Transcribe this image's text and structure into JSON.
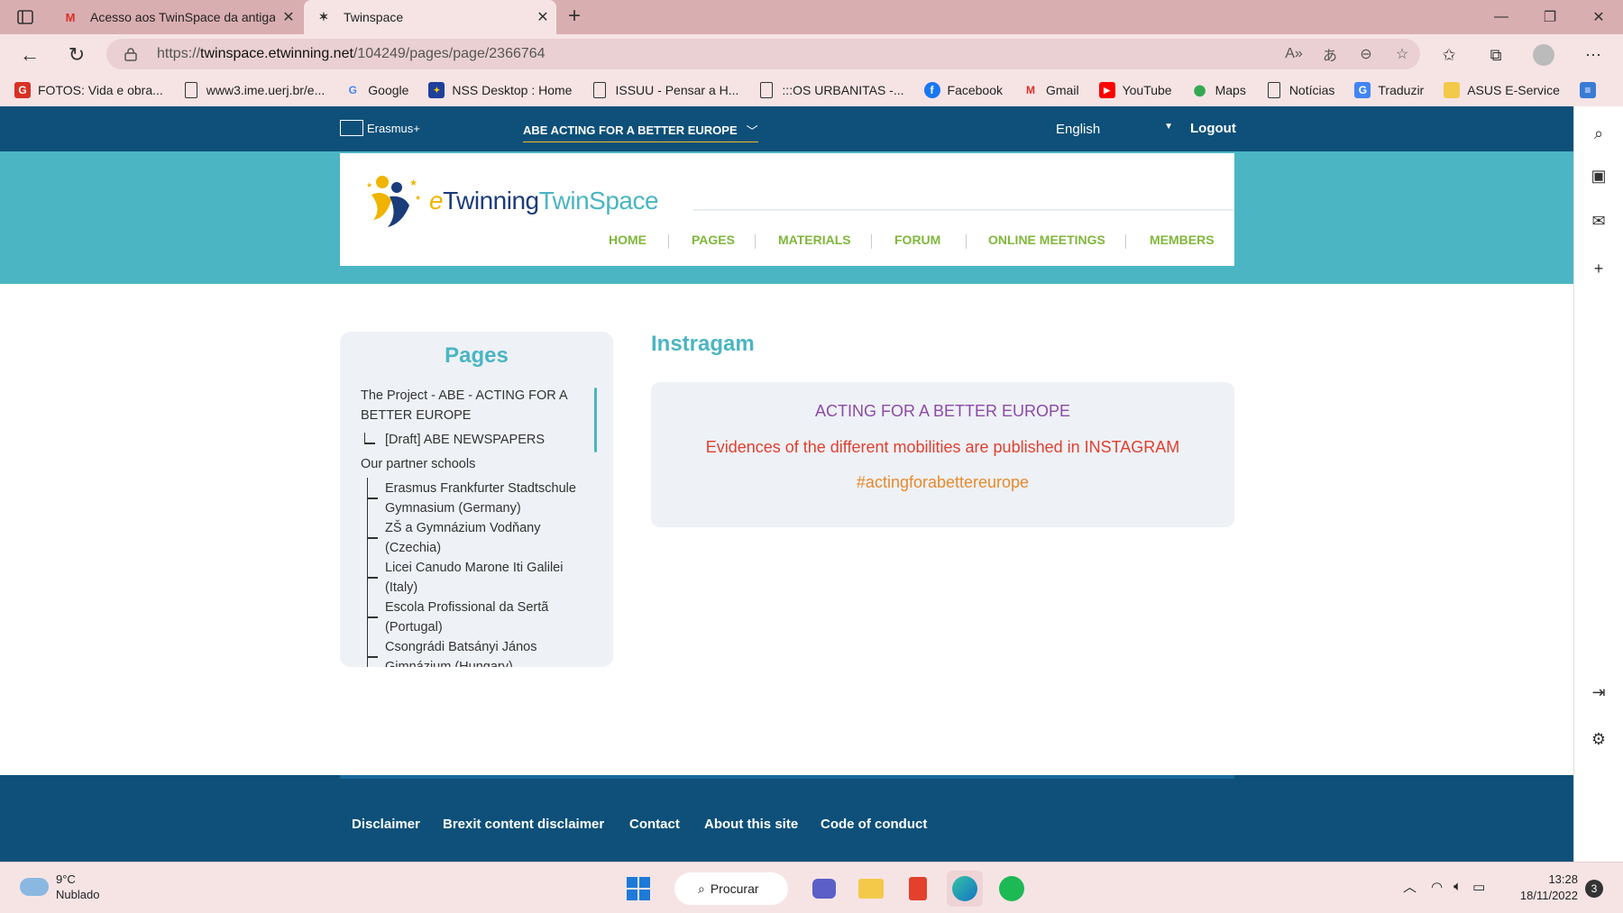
{
  "browser": {
    "tabs": [
      {
        "title": "Acesso aos TwinSpace da antiga",
        "favicon": "gmail-icon"
      },
      {
        "title": "Twinspace",
        "favicon": "twinspace-icon",
        "active": true
      }
    ],
    "address": {
      "prefix": "https://",
      "host": "twinspace.etwinning.net",
      "path": "/104249/pages/page/2366764"
    },
    "bookmarks": [
      {
        "label": "FOTOS: Vida e obra...",
        "icon": "gmail-red-icon"
      },
      {
        "label": "www3.ime.uerj.br/e...",
        "icon": "page-icon"
      },
      {
        "label": "Google",
        "icon": "google-icon"
      },
      {
        "label": "NSS Desktop : Home",
        "icon": "eu-flag-icon"
      },
      {
        "label": "ISSUU - Pensar a H...",
        "icon": "page-icon"
      },
      {
        "label": ":::OS URBANITAS -...",
        "icon": "page-icon"
      },
      {
        "label": "Facebook",
        "icon": "facebook-icon"
      },
      {
        "label": "Gmail",
        "icon": "gmail-icon"
      },
      {
        "label": "YouTube",
        "icon": "youtube-icon"
      },
      {
        "label": "Maps",
        "icon": "maps-icon"
      },
      {
        "label": "Notícias",
        "icon": "page-icon"
      },
      {
        "label": "Traduzir",
        "icon": "translate-icon"
      },
      {
        "label": "ASUS E-Service",
        "icon": "folder-icon"
      }
    ]
  },
  "site": {
    "topbar": {
      "brand": "Erasmus+",
      "project": "ABE ACTING FOR A BETTER EUROPE",
      "language": "English",
      "logout": "Logout"
    },
    "logo": {
      "part1": "Twinning",
      "part2": "TwinSpace",
      "e": "e"
    },
    "nav": [
      "HOME",
      "PAGES",
      "MATERIALS",
      "FORUM",
      "ONLINE MEETINGS",
      "MEMBERS"
    ],
    "sidebar": {
      "title": "Pages",
      "items": [
        {
          "label1": "The Project - ABE - ACTING FOR A",
          "label2": "BETTER EUROPE"
        },
        {
          "label1": "[Draft] ABE NEWSPAPERS"
        },
        {
          "label1": "Our partner schools"
        },
        {
          "label1": "Erasmus Frankfurter Stadtschule",
          "label2": "Gymnasium (Germany)"
        },
        {
          "label1": "ZŠ a Gymnázium Vodňany",
          "label2": "(Czechia)"
        },
        {
          "label1": "Licei Canudo Marone Iti Galilei",
          "label2": "(Italy)"
        },
        {
          "label1": "Escola Profissional da Sertã",
          "label2": "(Portugal)"
        },
        {
          "label1": "Csongrádi Batsányi János",
          "label2": "Gimnázium (Hungary)"
        }
      ]
    },
    "content": {
      "title": "Instragam",
      "line1": "ACTING FOR A BETTER EUROPE",
      "line2": "Evidences of the different mobilities are published in INSTAGRAM",
      "line3": "#actingforabettereurope"
    },
    "footer": [
      "Disclaimer",
      "Brexit content disclaimer",
      "Contact",
      "About this site",
      "Code of conduct"
    ]
  },
  "taskbar": {
    "weather_temp": "9°C",
    "weather_desc": "Nublado",
    "search": "Procurar",
    "time": "13:28",
    "date": "18/11/2022",
    "notifications": "3"
  },
  "colors": {
    "site_blue": "#0e5079",
    "teal": "#4bb5c3",
    "nav_green": "#80b73c",
    "purple": "#8c4aa8",
    "red": "#e04030",
    "orange": "#e68a2e"
  }
}
